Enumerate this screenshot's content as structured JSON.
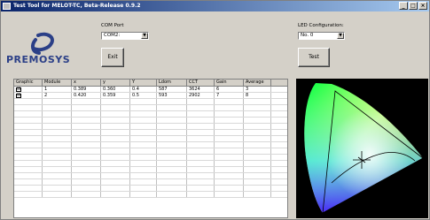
{
  "window": {
    "title": "Test Tool for MELOT-TC, Beta-Release 0.9.2"
  },
  "logo": {
    "text": "PREMOSYS"
  },
  "com_port": {
    "label": "COM Port",
    "value": "COM2:"
  },
  "led_config": {
    "label": "LED Configuration:",
    "value": "No. 0"
  },
  "buttons": {
    "exit": "Exit",
    "test": "Test"
  },
  "table": {
    "headers": [
      "Graphic",
      "Module",
      "x",
      "y",
      "Y",
      "Ldom",
      "CCT",
      "Gain",
      "Average"
    ],
    "rows": [
      [
        "☑",
        "1",
        "0.389",
        "0.360",
        "0.4",
        "587",
        "3624",
        "6",
        "3"
      ],
      [
        "☑",
        "2",
        "0.420",
        "0.359",
        "0.5",
        "593",
        "2902",
        "7",
        "8"
      ]
    ]
  },
  "colors": {
    "logo": "#2b3f87",
    "title_start": "#0a246a",
    "title_end": "#a6caf0"
  }
}
